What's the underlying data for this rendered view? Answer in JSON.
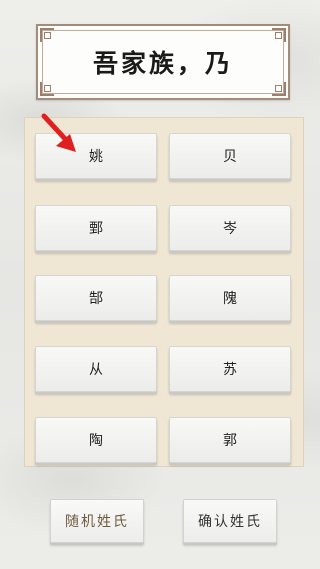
{
  "title": {
    "text": "吾家族，乃"
  },
  "surnames": [
    {
      "label": "姚"
    },
    {
      "label": "贝"
    },
    {
      "label": "鄄"
    },
    {
      "label": "岑"
    },
    {
      "label": "郜"
    },
    {
      "label": "隗"
    },
    {
      "label": "从"
    },
    {
      "label": "苏"
    },
    {
      "label": "陶"
    },
    {
      "label": "郭"
    }
  ],
  "actions": {
    "random_label": "随机姓氏",
    "confirm_label": "确认姓氏"
  },
  "colors": {
    "panel": "#efe6d4",
    "frame_border": "#a58c7a",
    "arrow": "#e02020",
    "random_text": "#6e5a3c"
  }
}
